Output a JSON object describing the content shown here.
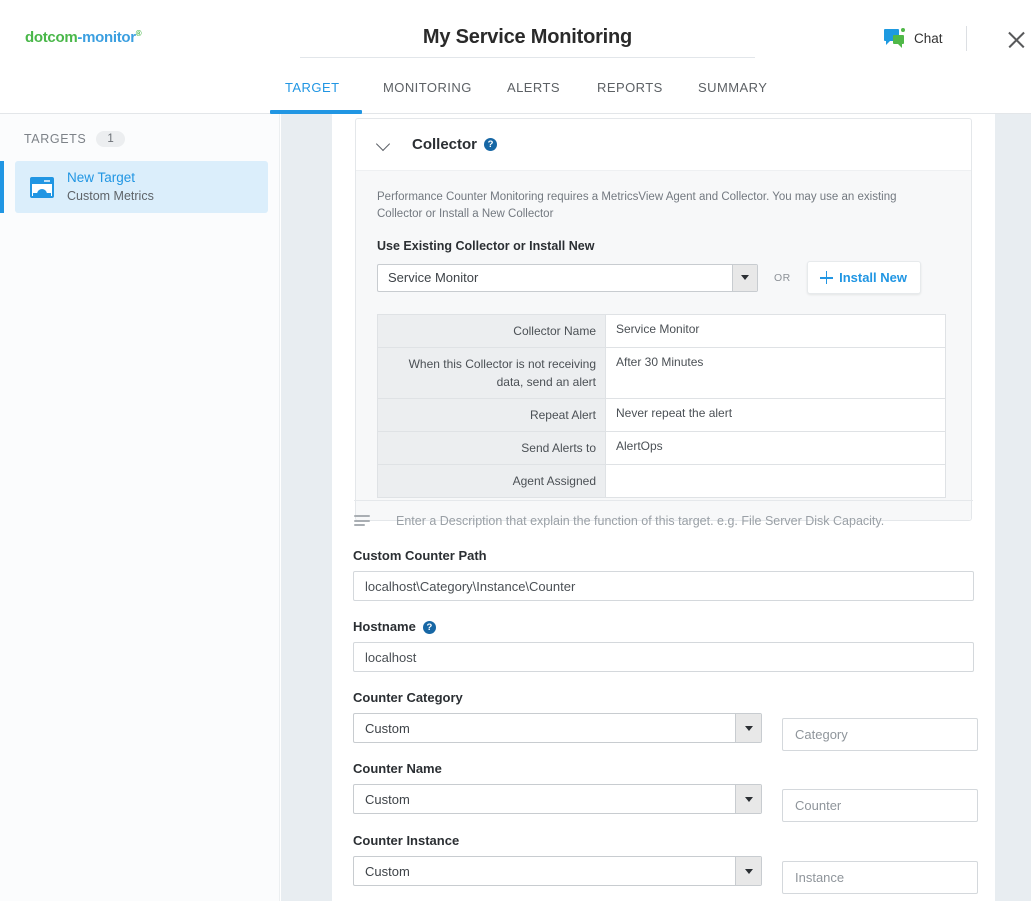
{
  "brand": {
    "name_part1": "dotcom",
    "name_part2": "-monitor",
    "registered": "®",
    "color_green": "#49b749",
    "color_blue": "#3b9fe0"
  },
  "header": {
    "title": "My Service Monitoring",
    "chat_label": "Chat",
    "chat_icon": "chat-bubble-icon",
    "close_icon": "close-icon"
  },
  "tabs": {
    "items": [
      {
        "label": "TARGET",
        "active": true
      },
      {
        "label": "MONITORING",
        "active": false
      },
      {
        "label": "ALERTS",
        "active": false
      },
      {
        "label": "REPORTS",
        "active": false
      },
      {
        "label": "SUMMARY",
        "active": false
      }
    ],
    "accent_color": "#2196e3"
  },
  "sidebar": {
    "section_label": "TARGETS",
    "count": "1",
    "items": [
      {
        "name": "New Target",
        "subtitle": "Custom Metrics",
        "icon": "target-window-icon",
        "selected": true
      }
    ]
  },
  "collector": {
    "section_title": "Collector",
    "help_icon": "help-icon",
    "help_glyph": "?",
    "chevron_icon": "chevron-down-icon",
    "description": "Performance Counter Monitoring requires a MetricsView Agent and Collector. You may use an existing Collector or Install a New Collector",
    "select_label": "Use Existing Collector or Install New",
    "selected_collector": "Service Monitor",
    "or_text": "OR",
    "install_button": "Install New",
    "install_icon": "plus-icon",
    "details": [
      {
        "key": "Collector Name",
        "value": "Service Monitor"
      },
      {
        "key": "When this Collector is not receiving data, send an alert",
        "value": "After 30 Minutes"
      },
      {
        "key": "Repeat Alert",
        "value": "Never repeat the alert"
      },
      {
        "key": "Send Alerts to",
        "value": "AlertOps"
      },
      {
        "key": "Agent Assigned",
        "value": ""
      }
    ]
  },
  "form": {
    "description_icon": "description-lines-icon",
    "description_placeholder": "Enter a Description that explain the function of this target. e.g. File Server Disk Capacity.",
    "counter_path": {
      "label": "Custom Counter Path",
      "value": "localhost\\Category\\Instance\\Counter"
    },
    "hostname": {
      "label": "Hostname",
      "help_icon": "help-icon",
      "help_glyph": "?",
      "value": "localhost"
    },
    "counter_category": {
      "label": "Counter Category",
      "select_value": "Custom",
      "text_placeholder": "Category"
    },
    "counter_name": {
      "label": "Counter Name",
      "select_value": "Custom",
      "text_placeholder": "Counter"
    },
    "counter_instance": {
      "label": "Counter Instance",
      "select_value": "Custom",
      "text_placeholder": "Instance"
    }
  }
}
